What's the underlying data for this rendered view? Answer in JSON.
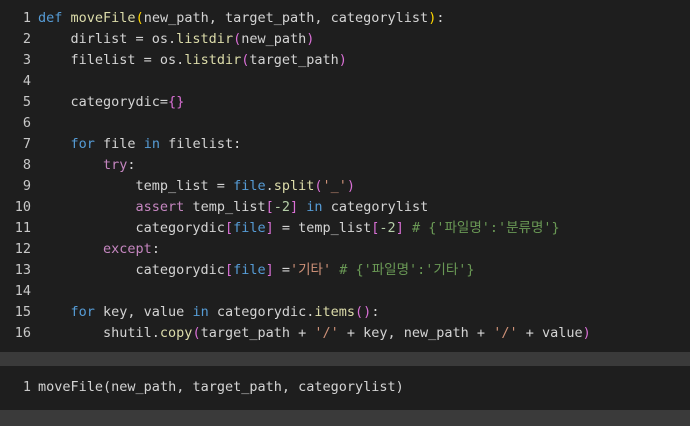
{
  "cell1": {
    "lines": [
      {
        "n": "1"
      },
      {
        "n": "2"
      },
      {
        "n": "3"
      },
      {
        "n": "4"
      },
      {
        "n": "5"
      },
      {
        "n": "6"
      },
      {
        "n": "7"
      },
      {
        "n": "8"
      },
      {
        "n": "9"
      },
      {
        "n": "10"
      },
      {
        "n": "11"
      },
      {
        "n": "12"
      },
      {
        "n": "13"
      },
      {
        "n": "14"
      },
      {
        "n": "15"
      },
      {
        "n": "16"
      }
    ],
    "tokens": {
      "l1": [
        "def",
        " ",
        "moveFile",
        "(",
        "new_path, target_path, categorylist",
        ")",
        ":"
      ],
      "l2": [
        "    dirlist = os.",
        "listdir",
        "(",
        "new_path",
        ")"
      ],
      "l3": [
        "    filelist = os.",
        "listdir",
        "(",
        "target_path",
        ")"
      ],
      "l5": [
        "    categorydic=",
        "{",
        "}"
      ],
      "l7": [
        "    ",
        "for",
        " file ",
        "in",
        " filelist:"
      ],
      "l8": [
        "        ",
        "try",
        ":"
      ],
      "l9": [
        "            temp_list = ",
        "file",
        ".",
        "split",
        "(",
        "'_'",
        ")"
      ],
      "l10": [
        "            ",
        "assert",
        " temp_list",
        "[",
        "-2",
        "]",
        " ",
        "in",
        " categorylist"
      ],
      "l11": [
        "            categorydic",
        "[",
        "file",
        "]",
        " = temp_list",
        "[",
        "-2",
        "]",
        " ",
        "# {'파일명':'분류명'}"
      ],
      "l12": [
        "        ",
        "except",
        ":"
      ],
      "l13": [
        "            categorydic",
        "[",
        "file",
        "]",
        " =",
        "'기타'",
        " ",
        "# {'파일명':'기타'}"
      ],
      "l15": [
        "    ",
        "for",
        " key, value ",
        "in",
        " categorydic.",
        "items",
        "(",
        ")",
        ":"
      ],
      "l16": [
        "        shutil.",
        "copy",
        "(",
        "target_path + ",
        "'/'",
        " + key, new_path + ",
        "'/'",
        " + value",
        ")"
      ]
    }
  },
  "cell2": {
    "n": "1",
    "tokens": [
      "moveFile",
      "(",
      "new_path, target_path, categorylist",
      ")"
    ]
  }
}
